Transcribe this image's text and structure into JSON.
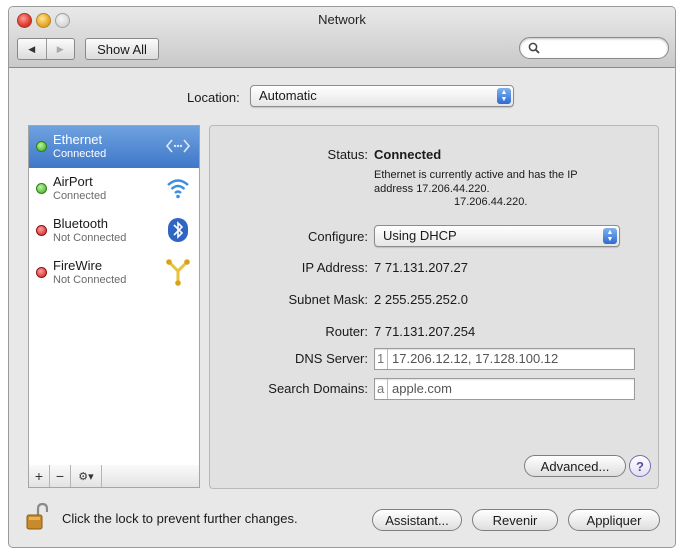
{
  "window": {
    "title": "Network"
  },
  "toolbar": {
    "back_glyph": "◀",
    "forward_glyph": "▶",
    "show_all_label": "Show All",
    "search_icon_glyph": "🔍",
    "search_placeholder": ""
  },
  "location": {
    "label": "Location:",
    "value": "Automatic"
  },
  "sidebar": {
    "services": [
      {
        "name": "Ethernet",
        "status": "Connected",
        "status_color": "green",
        "icon": "ethernet-icon",
        "selected": true
      },
      {
        "name": "AirPort",
        "status": "Connected",
        "status_color": "green",
        "icon": "wifi-icon",
        "selected": false
      },
      {
        "name": "Bluetooth",
        "status": "Not Connected",
        "status_color": "red",
        "icon": "bluetooth-icon",
        "selected": false
      },
      {
        "name": "FireWire",
        "status": "Not Connected",
        "status_color": "red",
        "icon": "firewire-icon",
        "selected": false
      }
    ],
    "tools": {
      "add": "+",
      "remove": "−",
      "gear": "⚙▾"
    }
  },
  "detail": {
    "status_label": "Status:",
    "status_value": "Connected",
    "status_description": "Ethernet is currently active and has the IP address 17.206.44.220.",
    "status_description_ip": "17.206.44.220.",
    "configure_label": "Configure:",
    "configure_value": "Using DHCP",
    "ip_label": "IP Address:",
    "ip_value": "7  71.131.207.27",
    "subnet_label": "Subnet Mask:",
    "subnet_value": "2  255.255.252.0",
    "router_label": "Router:",
    "router_value": "7  71.131.207.254",
    "dns_label": "DNS Server:",
    "dns_stub": "1",
    "dns_value": "17.206.12.12, 17.128.100.12",
    "search_domains_label": "Search Domains:",
    "search_domains_stub": "a",
    "search_domains_value": "apple.com",
    "advanced_label": "Advanced...",
    "help_label": "?"
  },
  "footer": {
    "lock_text": "Click the lock to prevent further changes.",
    "assistant_label": "Assistant...",
    "revert_label": "Revenir",
    "apply_label": "Appliquer"
  },
  "colors": {
    "selection_blue": "#3f78c9",
    "status_green": "#3aa81f",
    "status_red": "#c81c1c",
    "popup_arrow_blue": "#2f6ad3",
    "help_purple": "#5b47ad"
  }
}
